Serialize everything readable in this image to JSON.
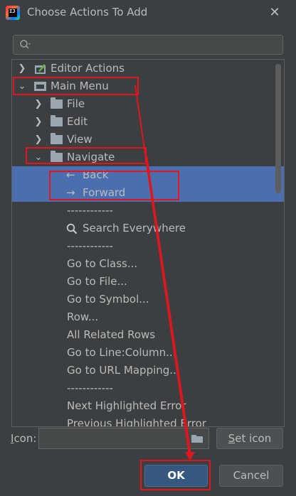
{
  "window": {
    "title": "Choose Actions To Add",
    "close_glyph": "✕"
  },
  "search": {
    "placeholder": "",
    "value": ""
  },
  "tree": {
    "editor_actions": "Editor Actions",
    "main_menu": "Main Menu",
    "file": "File",
    "edit": "Edit",
    "view": "View",
    "navigate": "Navigate",
    "back": "Back",
    "forward": "Forward",
    "sep1": "------------",
    "search_everywhere": "Search Everywhere",
    "sep2": "------------",
    "goto_class": "Go to Class...",
    "goto_file": "Go to File...",
    "goto_symbol": "Go to Symbol...",
    "row": "Row...",
    "all_related_rows": "All Related Rows",
    "goto_line": "Go to Line:Column...",
    "goto_url": "Go to URL Mapping...",
    "sep3": "------------",
    "next_error": "Next Highlighted Error",
    "prev_error": "Previous Highlighted Error"
  },
  "footer": {
    "icon_label_mnemonic": "I",
    "icon_label_rest": "con:",
    "icon_value": "",
    "set_icon_mnemonic": "S",
    "set_icon_rest": "et icon",
    "ok_label": "OK",
    "cancel_label": "Cancel"
  },
  "colors": {
    "background": "#3c3f41",
    "selection": "#4b6eaf",
    "annotation_red": "#e0161c",
    "ok_button": "#365880"
  },
  "icons": [
    "app-logo-icon",
    "close-icon",
    "search-icon",
    "chevron-right-icon",
    "chevron-down-icon",
    "folder-icon",
    "editor-actions-icon",
    "main-menu-icon",
    "back-arrow-icon",
    "forward-arrow-icon",
    "magnifier-icon",
    "open-folder-icon"
  ]
}
